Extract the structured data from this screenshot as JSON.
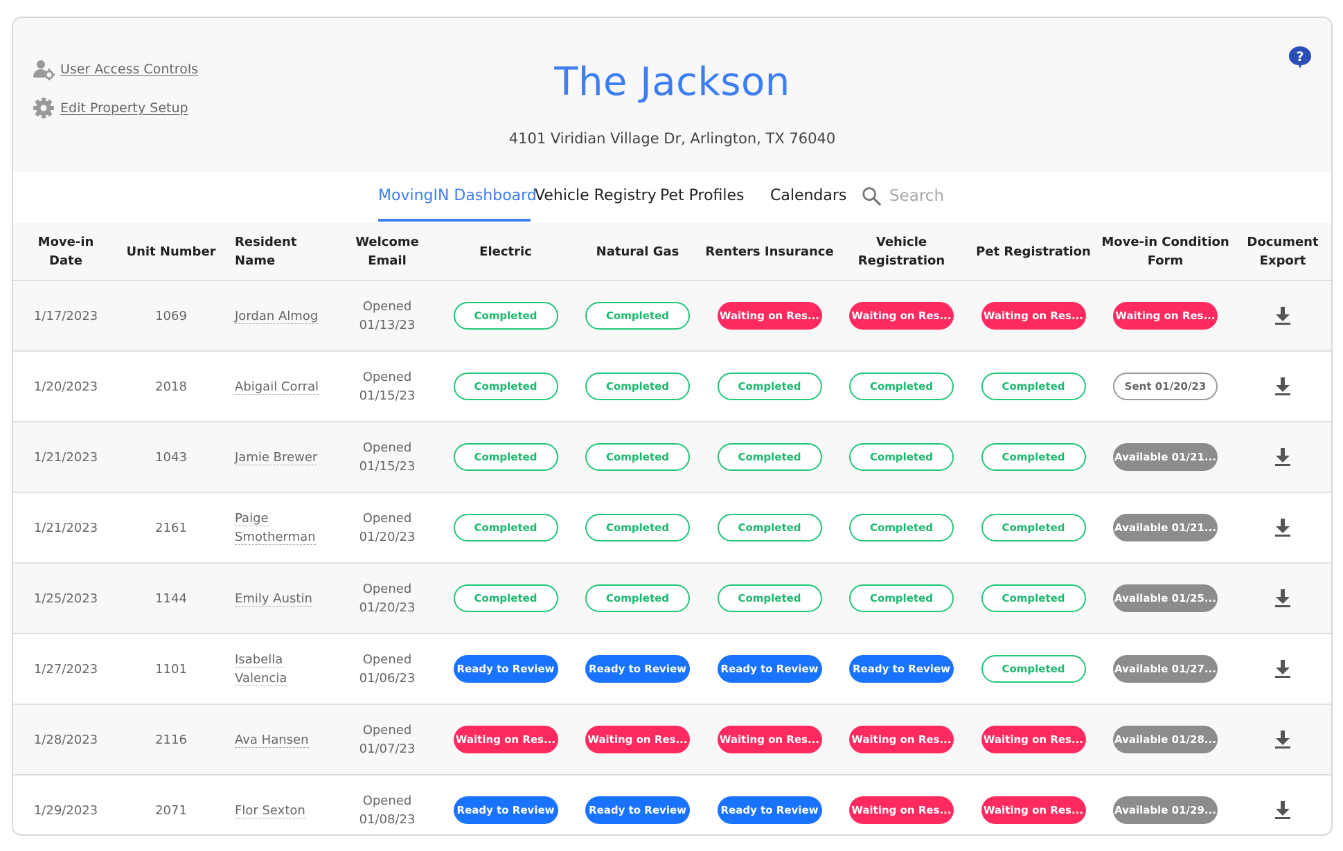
{
  "header": {
    "admin_links": [
      {
        "label": "User Access Controls",
        "icon": "user-gear-icon"
      },
      {
        "label": "Edit Property Setup",
        "icon": "gear-icon"
      }
    ],
    "property_name": "The Jackson",
    "address": "4101 Viridian Village Dr, Arlington, TX 76040",
    "help_icon": "help-question-icon"
  },
  "tabs": [
    {
      "label": "MovingIN Dashboard",
      "active": true
    },
    {
      "label": "Vehicle Registry",
      "active": false
    },
    {
      "label": "Pet Profiles",
      "active": false
    },
    {
      "label": "Calendars",
      "active": false
    }
  ],
  "search": {
    "placeholder": "Search",
    "icon": "search-icon"
  },
  "table": {
    "columns": [
      [
        "Move-in",
        "Date"
      ],
      [
        "Unit Number"
      ],
      [
        "Resident",
        "Name"
      ],
      [
        "Welcome",
        "Email"
      ],
      [
        "Electric"
      ],
      [
        "Natural Gas"
      ],
      [
        "Renters Insurance"
      ],
      [
        "Vehicle",
        "Registration"
      ],
      [
        "Pet Registration"
      ],
      [
        "Move-in Condition",
        "Form"
      ],
      [
        "Document",
        "Export"
      ]
    ],
    "rows": [
      {
        "date": "1/17/2023",
        "unit": "1069",
        "name": [
          "Jordan Almog"
        ],
        "email": [
          "Opened",
          "01/13/23"
        ],
        "statuses": [
          [
            "completed",
            "Completed"
          ],
          [
            "completed",
            "Completed"
          ],
          [
            "waiting",
            "Waiting on Res..."
          ],
          [
            "waiting",
            "Waiting on Res..."
          ],
          [
            "waiting",
            "Waiting on Res..."
          ],
          [
            "waiting",
            "Waiting on Res..."
          ]
        ]
      },
      {
        "date": "1/20/2023",
        "unit": "2018",
        "name": [
          "Abigail Corral"
        ],
        "email": [
          "Opened",
          "01/15/23"
        ],
        "statuses": [
          [
            "completed",
            "Completed"
          ],
          [
            "completed",
            "Completed"
          ],
          [
            "completed",
            "Completed"
          ],
          [
            "completed",
            "Completed"
          ],
          [
            "completed",
            "Completed"
          ],
          [
            "sent",
            "Sent 01/20/23"
          ]
        ]
      },
      {
        "date": "1/21/2023",
        "unit": "1043",
        "name": [
          "Jamie Brewer"
        ],
        "email": [
          "Opened",
          "01/15/23"
        ],
        "statuses": [
          [
            "completed",
            "Completed"
          ],
          [
            "completed",
            "Completed"
          ],
          [
            "completed",
            "Completed"
          ],
          [
            "completed",
            "Completed"
          ],
          [
            "completed",
            "Completed"
          ],
          [
            "available",
            "Available 01/21..."
          ]
        ]
      },
      {
        "date": "1/21/2023",
        "unit": "2161",
        "name": [
          "Paige",
          "Smotherman"
        ],
        "email": [
          "Opened",
          "01/20/23"
        ],
        "statuses": [
          [
            "completed",
            "Completed"
          ],
          [
            "completed",
            "Completed"
          ],
          [
            "completed",
            "Completed"
          ],
          [
            "completed",
            "Completed"
          ],
          [
            "completed",
            "Completed"
          ],
          [
            "available",
            "Available 01/21..."
          ]
        ]
      },
      {
        "date": "1/25/2023",
        "unit": "1144",
        "name": [
          "Emily Austin"
        ],
        "email": [
          "Opened",
          "01/20/23"
        ],
        "statuses": [
          [
            "completed",
            "Completed"
          ],
          [
            "completed",
            "Completed"
          ],
          [
            "completed",
            "Completed"
          ],
          [
            "completed",
            "Completed"
          ],
          [
            "completed",
            "Completed"
          ],
          [
            "available",
            "Available 01/25..."
          ]
        ]
      },
      {
        "date": "1/27/2023",
        "unit": "1101",
        "name": [
          "Isabella",
          "Valencia"
        ],
        "email": [
          "Opened",
          "01/06/23"
        ],
        "statuses": [
          [
            "review",
            "Ready to Review"
          ],
          [
            "review",
            "Ready to Review"
          ],
          [
            "review",
            "Ready to Review"
          ],
          [
            "review",
            "Ready to Review"
          ],
          [
            "completed",
            "Completed"
          ],
          [
            "available",
            "Available 01/27..."
          ]
        ]
      },
      {
        "date": "1/28/2023",
        "unit": "2116",
        "name": [
          "Ava Hansen"
        ],
        "email": [
          "Opened",
          "01/07/23"
        ],
        "statuses": [
          [
            "waiting",
            "Waiting on Res..."
          ],
          [
            "waiting",
            "Waiting on Res..."
          ],
          [
            "waiting",
            "Waiting on Res..."
          ],
          [
            "waiting",
            "Waiting on Res..."
          ],
          [
            "waiting",
            "Waiting on Res..."
          ],
          [
            "available",
            "Available 01/28..."
          ]
        ]
      },
      {
        "date": "1/29/2023",
        "unit": "2071",
        "name": [
          "Flor Sexton"
        ],
        "email": [
          "Opened",
          "01/08/23"
        ],
        "statuses": [
          [
            "review",
            "Ready to Review"
          ],
          [
            "review",
            "Ready to Review"
          ],
          [
            "review",
            "Ready to Review"
          ],
          [
            "waiting",
            "Waiting on Res..."
          ],
          [
            "waiting",
            "Waiting on Res..."
          ],
          [
            "available",
            "Available 01/29..."
          ]
        ]
      }
    ],
    "export_icon": "download-icon"
  },
  "colors": {
    "accent": "#3d7ef0",
    "completed": "#22c57a",
    "waiting": "#ff2a5f",
    "review": "#1a73ff",
    "available": "#8c8c8c"
  }
}
